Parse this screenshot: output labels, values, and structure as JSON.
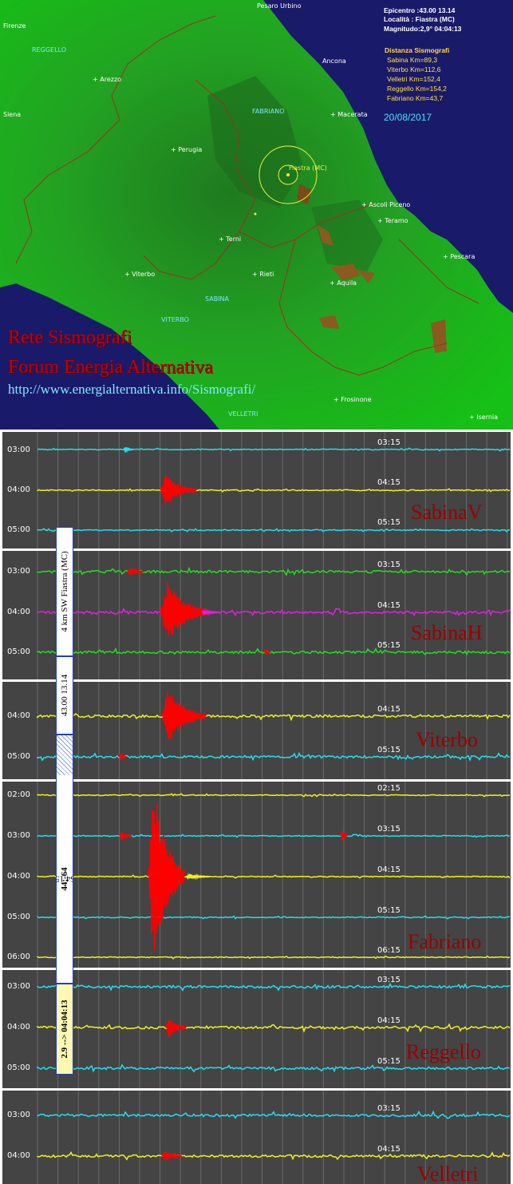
{
  "map": {
    "info": {
      "epicentro": "Epicentro :43.00 13.14",
      "localita": "Località : Fiastra (MC)",
      "magnitudo": "Magnitudo:2,9°  04:04:13"
    },
    "distanze_title": "Distanza Sismografi",
    "distanze": [
      "Sabina Km=89,3",
      "Viterbo Km=112,6",
      "Velletri Km=152,4",
      "Reggello Km=154,2",
      "Fabriano Km=43,7"
    ],
    "date": "20/08/2017",
    "epicenter_label": "Fiastra (MC)",
    "cities": {
      "firenze": "Firenze",
      "reggello": "REGGELLO",
      "arezzo": "+ Arezzo",
      "siena": "Siena",
      "fabriano": "FABRIANO",
      "macerata": "+ Macerata",
      "perugia": "+ Perugia",
      "ascoli": "+ Ascoli Piceno",
      "teramo": "+ Teramo",
      "terni": "+ Terni",
      "pescara": "+ Pescara",
      "viterbo_city": "+ Viterbo",
      "rieti": "+ Rieti",
      "sabina": "SABINA",
      "aquila": "+ Aquila",
      "viterbo": "VITERBO",
      "frosinone": "+ Frosinone",
      "velletri": "VELLETRI",
      "isernia": "+ Isernia",
      "pesaro": "Pesaro Urbino",
      "ancona": "Ancona"
    },
    "brand": {
      "line1": "Rete Sismografi",
      "line2": "Forum Energia Alternativa",
      "url": "http://www.energialternativa.info/Sismografi/"
    }
  },
  "colors": {
    "cyan": "#20e0f0",
    "yellow": "#f0f020",
    "green": "#20e020",
    "magenta": "#e020e0",
    "event": "#ff0000",
    "panel_bg": "#444444"
  },
  "panels": [
    {
      "name": "SabinaV",
      "rows": [
        {
          "label": "03:00",
          "mark": "03:15",
          "color": "cyan"
        },
        {
          "label": "04:00",
          "mark": "04:15",
          "color": "yellow"
        },
        {
          "label": "05:00",
          "mark": "05:15",
          "color": "cyan"
        }
      ]
    },
    {
      "name": "SabinaH",
      "rows": [
        {
          "label": "03:00",
          "mark": "03:15",
          "color": "green"
        },
        {
          "label": "04:00",
          "mark": "04:15",
          "color": "magenta"
        },
        {
          "label": "05:00",
          "mark": "05:15",
          "color": "green"
        }
      ]
    },
    {
      "name": "Viterbo",
      "rows": [
        {
          "label": "04:00",
          "mark": "04:15",
          "color": "yellow"
        },
        {
          "label": "05:00",
          "mark": "05:15",
          "color": "cyan"
        }
      ]
    },
    {
      "name": "Fabriano",
      "rows": [
        {
          "label": "02:00",
          "mark": "02:15",
          "color": "yellow"
        },
        {
          "label": "03:00",
          "mark": "03:15",
          "color": "cyan"
        },
        {
          "label": "04:00",
          "mark": "04:15",
          "color": "yellow"
        },
        {
          "label": "05:00",
          "mark": "05:15",
          "color": "cyan"
        },
        {
          "label": "06:00",
          "mark": "06:15",
          "color": "yellow"
        }
      ]
    },
    {
      "name": "Reggello",
      "rows": [
        {
          "label": "03:00",
          "mark": "03:15",
          "color": "cyan"
        },
        {
          "label": "04:00",
          "mark": "04:15",
          "color": "yellow"
        },
        {
          "label": "05:00",
          "mark": "05:15",
          "color": "cyan"
        }
      ]
    },
    {
      "name": "Velletri",
      "rows": [
        {
          "label": "03:00",
          "mark": "03:15",
          "color": "cyan"
        },
        {
          "label": "04:00",
          "mark": "04:15",
          "color": "yellow"
        }
      ]
    }
  ],
  "vertical_box": {
    "location": "4 km SW Fiastra (MC)",
    "coords": "43.00 13.14",
    "distances": "9.89;61 113;54 151;-31 152;78",
    "distances_bold": "44;-64",
    "magnitude": "2.9 --> 04:04:13"
  }
}
